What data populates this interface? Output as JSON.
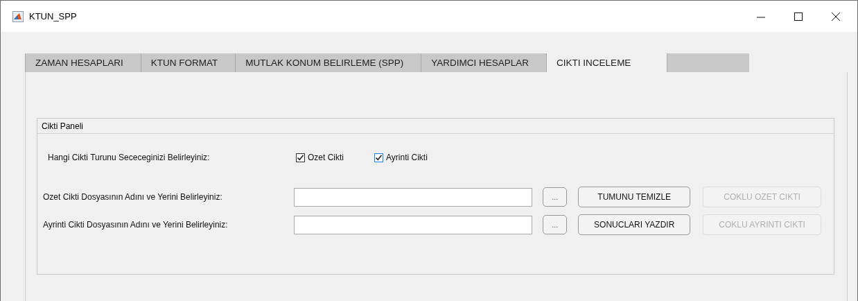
{
  "window": {
    "title": "KTUN_SPP"
  },
  "tabs": [
    {
      "label": "ZAMAN HESAPLARI",
      "selected": false
    },
    {
      "label": "KTUN FORMAT",
      "selected": false
    },
    {
      "label": "MUTLAK KONUM BELIRLEME (SPP)",
      "selected": false
    },
    {
      "label": "YARDIMCI HESAPLAR",
      "selected": false
    },
    {
      "label": "CIKTI INCELEME",
      "selected": true
    }
  ],
  "panel": {
    "title": "Cikti Paneli",
    "choice": {
      "label": "Hangi Cikti Turunu Sececeginizi Belirleyiniz:",
      "options": [
        {
          "label": "Ozet Cikti",
          "checked": true,
          "focused": false
        },
        {
          "label": "Ayrinti Cikti",
          "checked": true,
          "focused": true
        }
      ]
    },
    "rows": [
      {
        "label": "Ozet Cikti Dosyasının Adını ve Yerini Belirleyiniz:",
        "browse": "...",
        "action": {
          "label": "TUMUNU TEMIZLE",
          "disabled": false
        },
        "extra": {
          "label": "COKLU OZET CIKTI",
          "disabled": true
        }
      },
      {
        "label": "Ayrinti Cikti Dosyasının Adını ve Yerini Belirleyiniz:",
        "browse": "...",
        "action": {
          "label": "SONUCLARI YAZDIR",
          "disabled": false
        },
        "extra": {
          "label": "COKLU AYRINTI CIKTI",
          "disabled": true
        }
      }
    ]
  }
}
